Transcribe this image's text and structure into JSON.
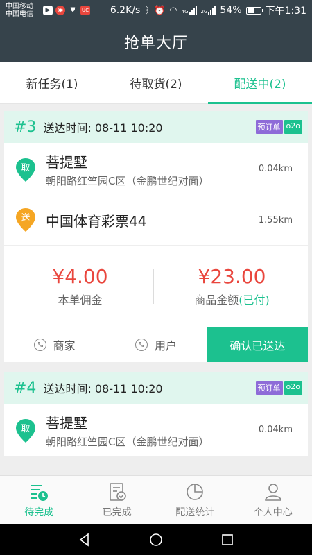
{
  "statusbar": {
    "carrier1": "中国移动",
    "carrier2": "中国电信",
    "speed": "6.2K/s",
    "net1": "4G",
    "net2": "2G",
    "battery": "54%",
    "battery_level": 0.54,
    "time": "下午1:31"
  },
  "header": {
    "title": "抢单大厅"
  },
  "tabs": [
    {
      "label": "新任务(1)"
    },
    {
      "label": "待取货(2)"
    },
    {
      "label": "配送中(2)"
    }
  ],
  "orders": [
    {
      "no": "#3",
      "time": "送达时间: 08-11 10:20",
      "badge1": "预订单",
      "badge2": "o2o",
      "pickup_tag": "取",
      "pickup_name": "菩提墅",
      "pickup_addr": "朝阳路红竺园C区（金鹏世纪对面）",
      "pickup_dist": "0.04km",
      "deliver_tag": "送",
      "deliver_name": "中国体育彩票44",
      "deliver_dist": "1.55km",
      "commission": "¥4.00",
      "commission_label": "本单佣金",
      "goods": "¥23.00",
      "goods_label": "商品金额",
      "paid": "(已付)",
      "btn_merchant": "商家",
      "btn_user": "用户",
      "btn_confirm": "确认已送达"
    },
    {
      "no": "#4",
      "time": "送达时间: 08-11 10:20",
      "badge1": "预订单",
      "badge2": "o2o",
      "pickup_tag": "取",
      "pickup_name": "菩提墅",
      "pickup_addr": "朝阳路红竺园C区（金鹏世纪对面）",
      "pickup_dist": "0.04km"
    }
  ],
  "bottomnav": [
    {
      "label": "待完成"
    },
    {
      "label": "已完成"
    },
    {
      "label": "配送统计"
    },
    {
      "label": "个人中心"
    }
  ],
  "colors": {
    "accent": "#1cc18f",
    "header": "#36434b",
    "price": "#e9463d",
    "pickup_pin": "#1cc18f",
    "deliver_pin": "#f5a623",
    "badge_preorder": "#8e6bd8",
    "badge_o2o": "#1cc18f"
  }
}
